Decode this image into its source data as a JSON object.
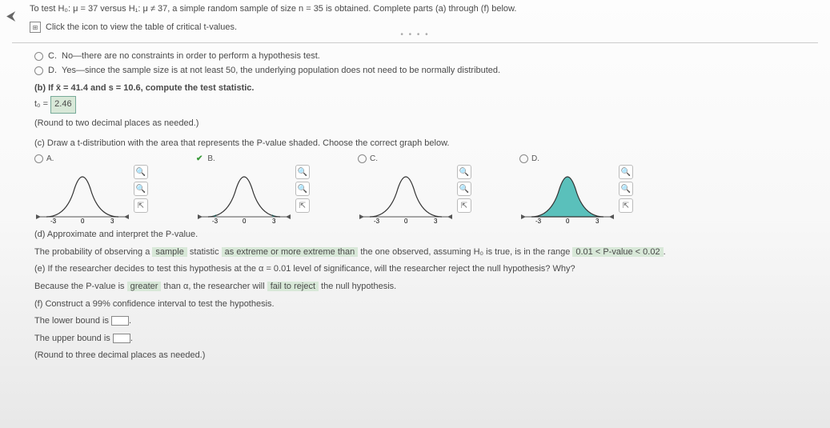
{
  "header": {
    "prompt": "To test H₀: μ = 37 versus H₁: μ ≠ 37, a simple random sample of size n = 35 is obtained. Complete parts (a) through (f) below.",
    "table_link": "Click the icon to view the table of critical t-values."
  },
  "options": {
    "c": {
      "letter": "C.",
      "text": "No—there are no constraints in order to perform a hypothesis test."
    },
    "d": {
      "letter": "D.",
      "text": "Yes—since the sample size is at not least 50, the underlying population does not need to be normally distributed."
    }
  },
  "part_b": {
    "label": "(b) If x̄ = 41.4 and s = 10.6, compute the test statistic.",
    "answer_prefix": "t₀ = ",
    "answer": "2.46",
    "round": "(Round to two decimal places as needed.)"
  },
  "part_c": {
    "label": "(c) Draw a t-distribution with the area that represents the P-value shaded. Choose the correct graph below.",
    "graphs": {
      "a": "A.",
      "b": "B.",
      "c": "C.",
      "d": "D.",
      "ticks": {
        "neg": "-3",
        "zero": "0",
        "pos": "3"
      }
    }
  },
  "part_d": {
    "label": "(d) Approximate and interpret the P-value.",
    "text_before": "The probability of observing a ",
    "blank1": "sample",
    "text_mid1": " statistic ",
    "blank2": "as extreme or more extreme than",
    "text_mid2": " the one observed, assuming ",
    "h0": "H₀",
    "text_mid3": " is true, is in the range ",
    "blank3": "0.01 < P-value < 0.02"
  },
  "part_e": {
    "label": "(e) If the researcher decides to test this hypothesis at the α = 0.01 level of significance, will the researcher reject the null hypothesis? Why?",
    "text_before": "Because the P-value is ",
    "blank1": "greater",
    "text_mid1": " than α, the researcher will ",
    "blank2": "fail to reject",
    "text_after": " the null hypothesis."
  },
  "part_f": {
    "label": "(f) Construct a 99% confidence interval to test the hypothesis.",
    "lower": "The lower bound is ",
    "upper": "The upper bound is ",
    "round": "(Round to three decimal places as needed.)"
  }
}
